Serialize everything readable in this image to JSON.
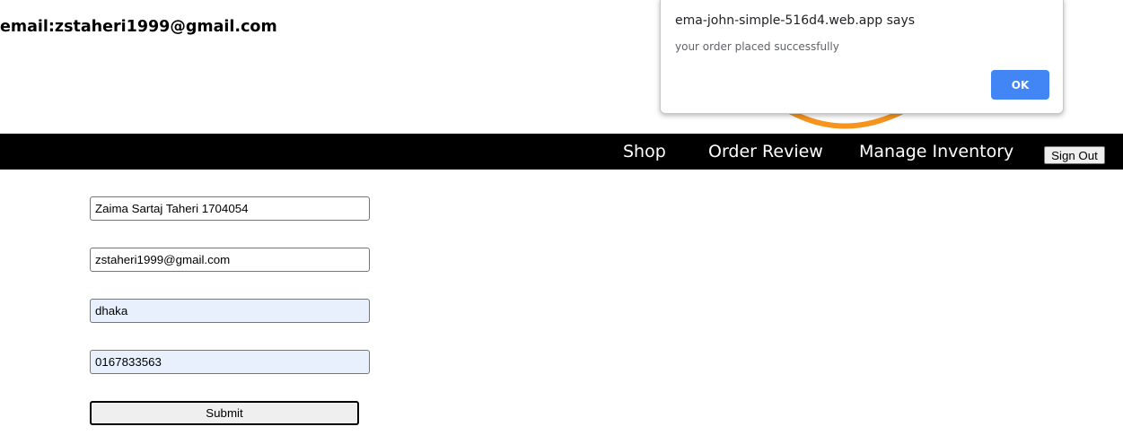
{
  "header": {
    "email_label": "email:zstaheri1999@gmail.com"
  },
  "logo": {
    "icon": "logo-arc-icon",
    "color": "#f7941d"
  },
  "nav": {
    "items": [
      {
        "label": "Shop"
      },
      {
        "label": "Order Review"
      },
      {
        "label": "Manage Inventory"
      }
    ],
    "sign_out_label": "Sign Out"
  },
  "form": {
    "name_value": "Zaima Sartaj Taheri 1704054",
    "email_value": "zstaheri1999@gmail.com",
    "address_value": "dhaka",
    "phone_value": "0167833563",
    "submit_label": "Submit"
  },
  "dialog": {
    "title": "ema-john-simple-516d4.web.app says",
    "message": "your order placed successfully",
    "ok_label": "OK",
    "ok_color": "#4285f4"
  }
}
